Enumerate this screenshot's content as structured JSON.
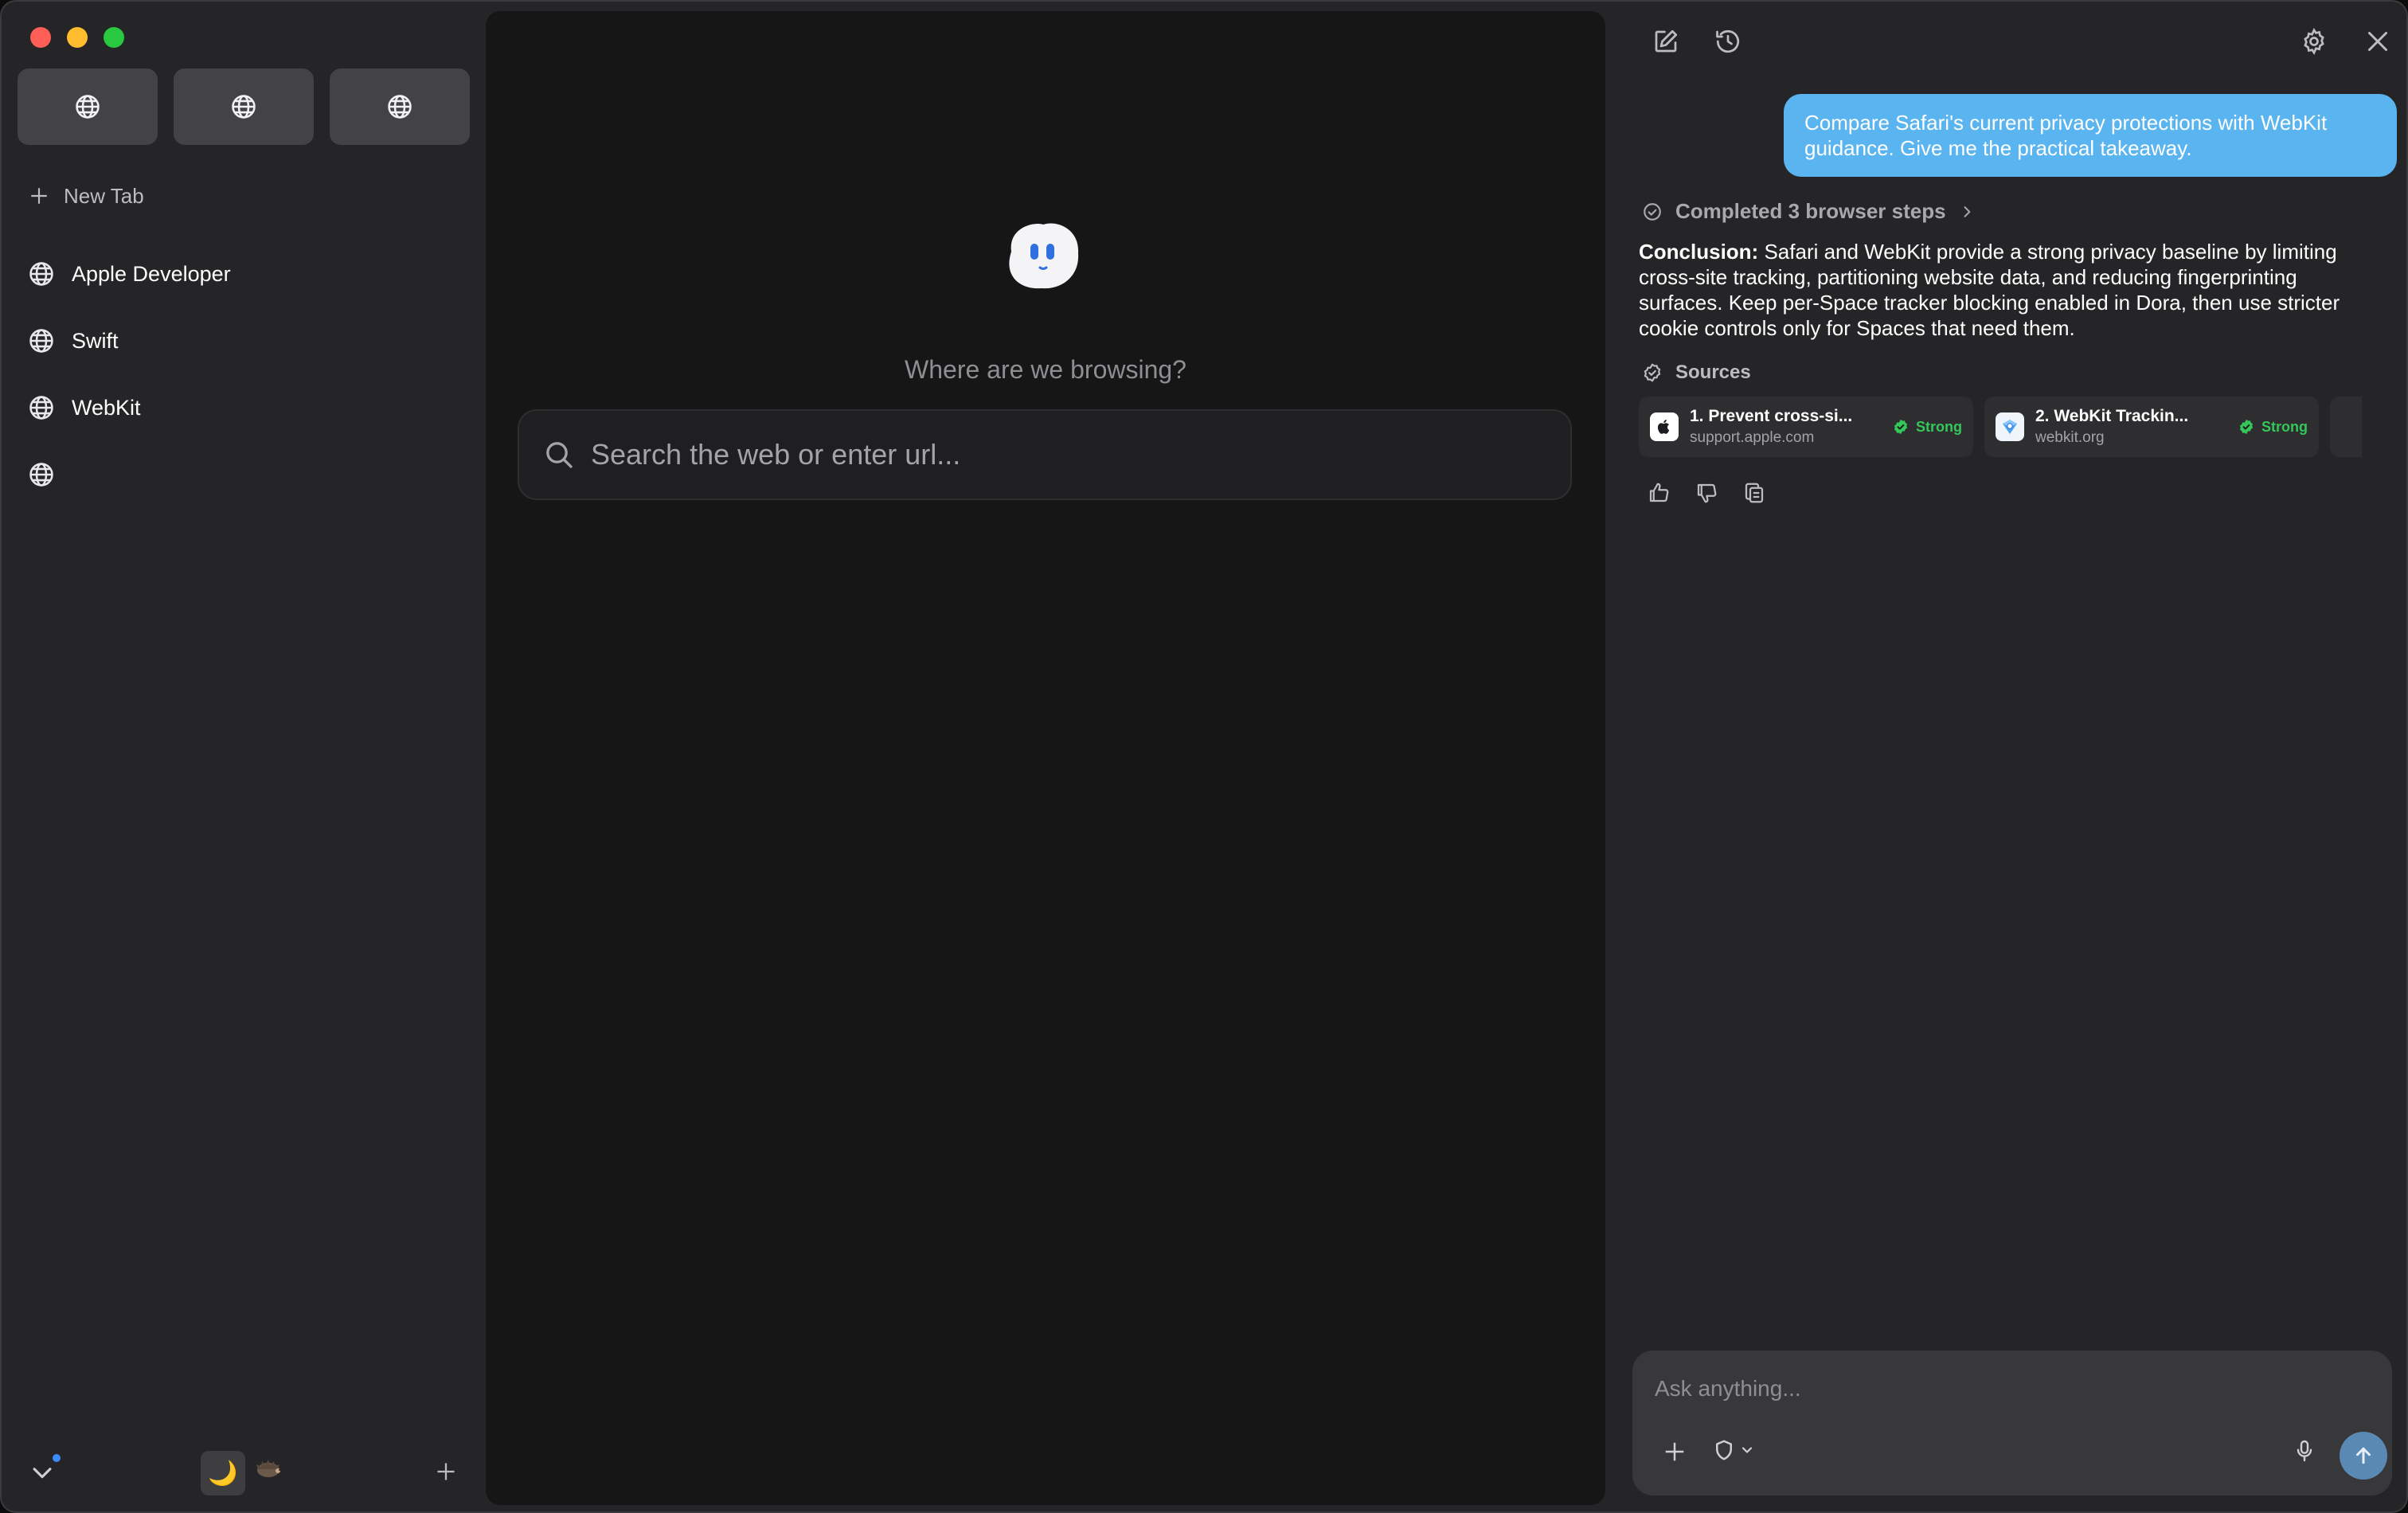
{
  "sidebar": {
    "new_tab_label": "New Tab",
    "items": [
      {
        "label": "Apple Developer",
        "icon": "globe-icon"
      },
      {
        "label": "Swift",
        "icon": "globe-icon"
      },
      {
        "label": "WebKit",
        "icon": "globe-icon"
      },
      {
        "label": "",
        "icon": "globe-icon"
      }
    ],
    "pinned": [
      "globe-icon",
      "globe-icon",
      "globe-icon"
    ],
    "theme_moon": "🌙"
  },
  "main": {
    "prompt": "Where are we browsing?",
    "search_placeholder": "Search the web or enter url..."
  },
  "assistant": {
    "user_message": "Compare Safari's current privacy protections with WebKit guidance. Give me the practical takeaway.",
    "steps_label": "Completed 3 browser steps",
    "conclusion_label": "Conclusion:",
    "conclusion_text": "Safari and WebKit provide a strong privacy baseline by limiting cross-site tracking, partitioning website data, and reducing fingerprinting surfaces. Keep per-Space tracker blocking enabled in Dora, then use stricter cookie controls only for Spaces that need them.",
    "sources_label": "Sources",
    "sources": [
      {
        "title": "1. Prevent cross-si...",
        "domain": "support.apple.com",
        "badge": "Strong"
      },
      {
        "title": "2. WebKit Trackin...",
        "domain": "webkit.org",
        "badge": "Strong"
      }
    ],
    "composer_placeholder": "Ask anything..."
  },
  "colors": {
    "accent_bubble": "#5ab4f0",
    "badge_green": "#34c759",
    "send_button": "#5a89b4"
  }
}
